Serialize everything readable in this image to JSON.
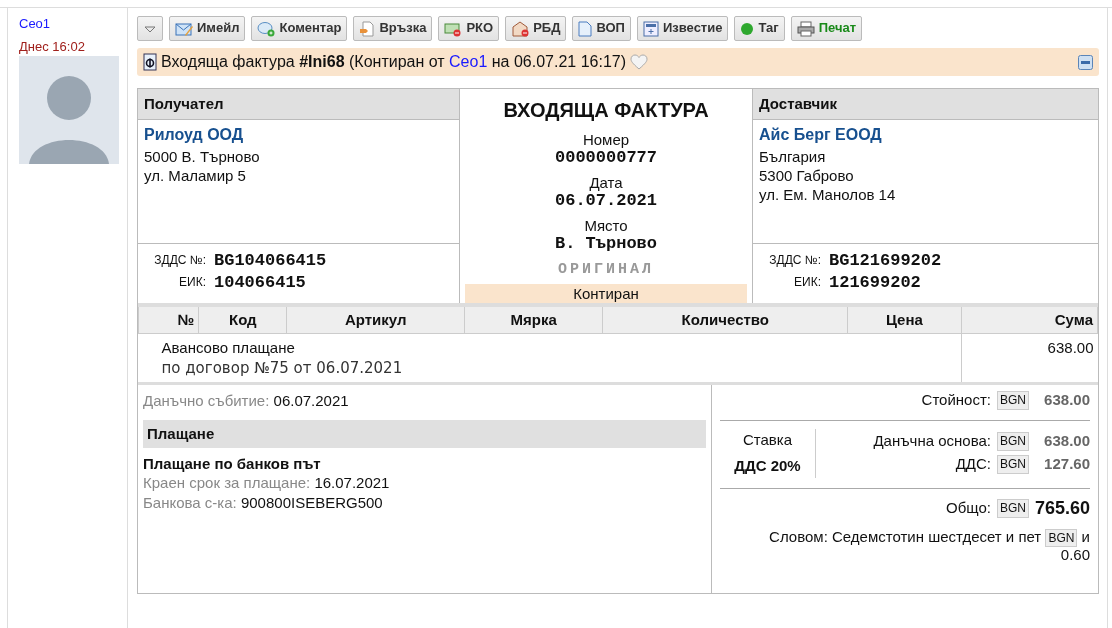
{
  "author": {
    "user": "Ceo1",
    "time": "Днес 16:02"
  },
  "toolbar": [
    {
      "kind": "dropdown"
    },
    {
      "kind": "email",
      "label": "Имейл"
    },
    {
      "kind": "comment",
      "label": "Коментар"
    },
    {
      "kind": "link",
      "label": "Връзка"
    },
    {
      "kind": "cash",
      "label": "РКО"
    },
    {
      "kind": "bank",
      "label": "РБД"
    },
    {
      "kind": "document",
      "label": "ВОП"
    },
    {
      "kind": "notice",
      "label": "Известие"
    },
    {
      "kind": "tag",
      "label": "Таг"
    },
    {
      "kind": "print",
      "label": "Печат"
    }
  ],
  "header": {
    "before": "Входяща фактура **#Ini68** (Контиран от",
    "user": "Ceo1",
    "after": "на 06.07.21 16:17)",
    "favorite": false
  },
  "recipient": {
    "heading": "Получател",
    "name": "Рилоуд ООД",
    "address": [
      "5000 В. Търново",
      "ул. Маламир 5"
    ],
    "vat_label": "ЗДДС №:",
    "vat": "BG104066415",
    "eik_label": "ЕИК:",
    "eik": "104066415"
  },
  "document": {
    "title": "ВХОДЯЩА ФАКТУРА",
    "fields": [
      {
        "label": "Номер",
        "value": "0000000777"
      },
      {
        "label": "Дата",
        "value": "06.07.2021"
      },
      {
        "label": "Място",
        "value": "В. Търново"
      }
    ],
    "copy": "ОРИГИНАЛ",
    "status": "Контиран"
  },
  "supplier": {
    "heading": "Доставчик",
    "name": "Айс Берг ЕООД",
    "address": [
      "България",
      "5300 Габрово",
      "ул. Ем. Манолов 14"
    ],
    "vat_label": "ЗДДС №:",
    "vat": "BG121699202",
    "eik_label": "ЕИК:",
    "eik": "121699202"
  },
  "table": {
    "columns": [
      "№",
      "Код",
      "Артикул",
      "Мярка",
      "Количество",
      "Цена",
      "Сума"
    ],
    "rows": [
      {
        "description": "Авансово плащане",
        "note": "по договор №75 от 06.07.2021",
        "amount": "638.00"
      }
    ]
  },
  "details": {
    "tax_event_label": "Данъчно събитие:",
    "tax_event": "06.07.2021",
    "payment_heading": "Плащане",
    "payment_method": "Плащане по банков път",
    "due_label": "Краен срок за плащане:",
    "due": "16.07.2021",
    "bank_label": "Банкова с-ка:",
    "bank": "900800ISEBERG500"
  },
  "totals": {
    "value_label": "Стойност:",
    "currency": "BGN",
    "value": "638.00",
    "rate_label": "Ставка",
    "rate": "ДДС 20%",
    "base_label": "Данъчна основа:",
    "base_currency": "BGN",
    "base": "638.00",
    "vat_label": "ДДС:",
    "vat_currency": "BGN",
    "vat": "127.60",
    "total_label": "Общо:",
    "total_currency": "BGN",
    "total": "765.60",
    "words": "Словом: Седемстотин шестдесет и пет",
    "words_currency": "BGN",
    "words_rest": "и",
    "words_fraction": "0.60"
  }
}
